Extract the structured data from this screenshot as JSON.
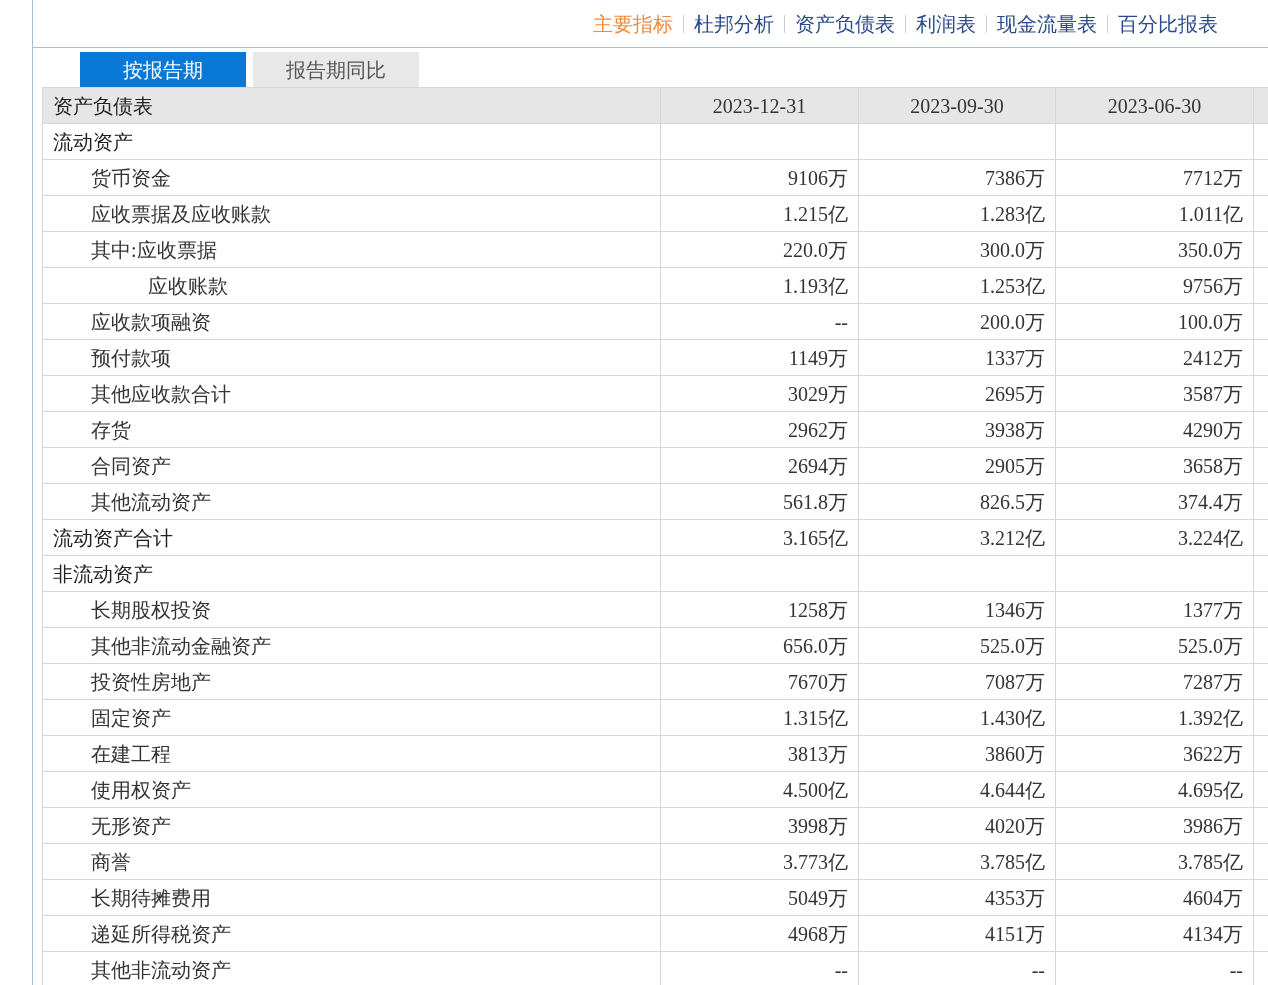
{
  "nav": [
    {
      "label": "主要指标",
      "selected": true
    },
    {
      "label": "杜邦分析",
      "selected": false
    },
    {
      "label": "资产负债表",
      "selected": false
    },
    {
      "label": "利润表",
      "selected": false
    },
    {
      "label": "现金流量表",
      "selected": false
    },
    {
      "label": "百分比报表",
      "selected": false
    }
  ],
  "tabs": [
    {
      "label": "按报告期",
      "selected": true
    },
    {
      "label": "报告期同比",
      "selected": false
    }
  ],
  "table": {
    "columns": [
      "资产负债表",
      "2023-12-31",
      "2023-09-30",
      "2023-06-30"
    ],
    "rows": [
      {
        "kind": "section",
        "label": "流动资产"
      },
      {
        "kind": "item",
        "label": "货币资金",
        "values": [
          "9106万",
          "7386万",
          "7712万"
        ]
      },
      {
        "kind": "item",
        "label": "应收票据及应收账款",
        "values": [
          "1.215亿",
          "1.283亿",
          "1.011亿"
        ]
      },
      {
        "kind": "item",
        "label": "其中:应收票据",
        "values": [
          "220.0万",
          "300.0万",
          "350.0万"
        ]
      },
      {
        "kind": "subitem",
        "label": "应收账款",
        "values": [
          "1.193亿",
          "1.253亿",
          "9756万"
        ]
      },
      {
        "kind": "item",
        "label": "应收款项融资",
        "values": [
          "--",
          "200.0万",
          "100.0万"
        ]
      },
      {
        "kind": "item",
        "label": "预付款项",
        "values": [
          "1149万",
          "1337万",
          "2412万"
        ]
      },
      {
        "kind": "item",
        "label": "其他应收款合计",
        "values": [
          "3029万",
          "2695万",
          "3587万"
        ]
      },
      {
        "kind": "item",
        "label": "存货",
        "values": [
          "2962万",
          "3938万",
          "4290万"
        ]
      },
      {
        "kind": "item",
        "label": "合同资产",
        "values": [
          "2694万",
          "2905万",
          "3658万"
        ]
      },
      {
        "kind": "item",
        "label": "其他流动资产",
        "values": [
          "561.8万",
          "826.5万",
          "374.4万"
        ]
      },
      {
        "kind": "section",
        "label": "流动资产合计",
        "values": [
          "3.165亿",
          "3.212亿",
          "3.224亿"
        ]
      },
      {
        "kind": "section",
        "label": "非流动资产"
      },
      {
        "kind": "item",
        "label": "长期股权投资",
        "values": [
          "1258万",
          "1346万",
          "1377万"
        ]
      },
      {
        "kind": "item",
        "label": "其他非流动金融资产",
        "values": [
          "656.0万",
          "525.0万",
          "525.0万"
        ]
      },
      {
        "kind": "item",
        "label": "投资性房地产",
        "values": [
          "7670万",
          "7087万",
          "7287万"
        ]
      },
      {
        "kind": "item",
        "label": "固定资产",
        "values": [
          "1.315亿",
          "1.430亿",
          "1.392亿"
        ]
      },
      {
        "kind": "item",
        "label": "在建工程",
        "values": [
          "3813万",
          "3860万",
          "3622万"
        ]
      },
      {
        "kind": "item",
        "label": "使用权资产",
        "values": [
          "4.500亿",
          "4.644亿",
          "4.695亿"
        ]
      },
      {
        "kind": "item",
        "label": "无形资产",
        "values": [
          "3998万",
          "4020万",
          "3986万"
        ]
      },
      {
        "kind": "item",
        "label": "商誉",
        "values": [
          "3.773亿",
          "3.785亿",
          "3.785亿"
        ]
      },
      {
        "kind": "item",
        "label": "长期待摊费用",
        "values": [
          "5049万",
          "4353万",
          "4604万"
        ]
      },
      {
        "kind": "item",
        "label": "递延所得税资产",
        "values": [
          "4968万",
          "4151万",
          "4134万"
        ]
      },
      {
        "kind": "item",
        "label": "其他非流动资产",
        "values": [
          "--",
          "--",
          "--"
        ]
      }
    ]
  }
}
